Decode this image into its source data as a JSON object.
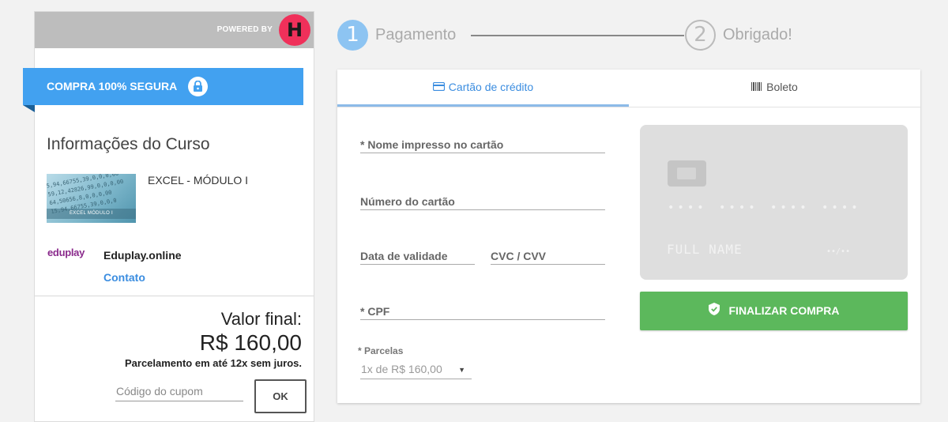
{
  "sidebar": {
    "powered_by": "POWERED BY",
    "hotmart_logo_glyph": "H",
    "secure_banner": "COMPRA 100% SEGURA",
    "info_title": "Informações do Curso",
    "course": {
      "name": "EXCEL - MÓDULO I",
      "thumbnail_caption": "EXCEL MÓDULO I",
      "thumbnail_numbers": [
        "5,94,66755,39,0,0,0,00",
        "59,12,42826,99,0,0,0,00",
        "64,50656,8,0,0,0,00",
        "15,94,66755,39,0,0,0"
      ]
    },
    "producer": {
      "logo_text": "eduplay",
      "name": "Eduplay.online",
      "contact_label": "Contato"
    },
    "final_label": "Valor final:",
    "final_price": "R$ 160,00",
    "installments_note": "Parcelamento em até 12x sem juros.",
    "coupon_placeholder": "Código do cupom",
    "ok_label": "OK"
  },
  "steps": [
    {
      "number": "1",
      "label": "Pagamento",
      "active": true
    },
    {
      "number": "2",
      "label": "Obrigado!",
      "active": false
    }
  ],
  "tabs": {
    "credit_card": "Cartão de crédito",
    "boleto": "Boleto"
  },
  "form": {
    "card_name_label": "* Nome impresso no cartão",
    "card_number_label": "Número do cartão",
    "expiry_label": "Data de validade",
    "cvc_label": "CVC / CVV",
    "cpf_label": "* CPF",
    "installments_label": "* Parcelas",
    "installments_value": "1x de R$ 160,00"
  },
  "card_preview": {
    "number_groups": [
      "••••",
      "••••",
      "••••",
      "••••"
    ],
    "full_name": "FULL NAME",
    "expiry": "••/••"
  },
  "finish_button": "FINALIZAR COMPRA",
  "colors": {
    "accent_blue": "#42a1f0",
    "link_blue": "#3b8de0",
    "finish_green": "#5cb85c",
    "hotmart_red": "#f0305a",
    "eduplay_purple": "#8a2a8c"
  }
}
